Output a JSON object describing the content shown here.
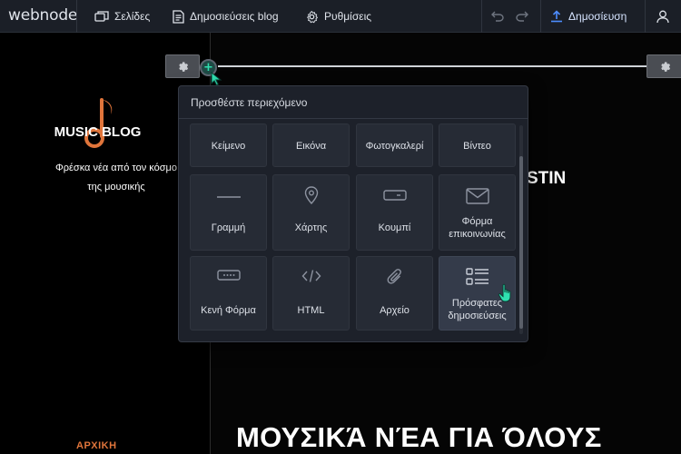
{
  "topbar": {
    "logo": "webnode",
    "nav": [
      {
        "label": "Σελίδες",
        "icon": "pages-icon"
      },
      {
        "label": "Δημοσιεύσεις blog",
        "icon": "blog-posts-icon"
      },
      {
        "label": "Ρυθμίσεις",
        "icon": "gear-icon"
      }
    ],
    "publish_label": "Δημοσίευση"
  },
  "site": {
    "blog_title": "MUSIC BLOG",
    "blog_subtitle_line1": "Φρέσκα νέα από τον κόσμο",
    "blog_subtitle_line2": "της μουσικής",
    "home_link": "ΑΡΧΙΚΗ",
    "partial_heading": "STIN",
    "big_heading": "ΜΟΥΣΙΚΆ ΝΈΑ ΓΙΑ ΌΛΟΥΣ"
  },
  "panel": {
    "title": "Προσθέστε περιεχόμενο",
    "row1": [
      "Κείμενο",
      "Εικόνα",
      "Φωτογκαλερί",
      "Βίντεο"
    ],
    "row2": [
      {
        "label1": "Γραμμή",
        "label2": "",
        "icon": "line-icon"
      },
      {
        "label1": "Χάρτης",
        "label2": "",
        "icon": "map-pin-icon"
      },
      {
        "label1": "Κουμπί",
        "label2": "",
        "icon": "button-icon"
      },
      {
        "label1": "Φόρμα",
        "label2": "επικοινωνίας",
        "icon": "envelope-icon"
      }
    ],
    "row3": [
      {
        "label1": "Κενή Φόρμα",
        "label2": "",
        "icon": "empty-form-icon"
      },
      {
        "label1": "HTML",
        "label2": "",
        "icon": "code-icon"
      },
      {
        "label1": "Αρχείο",
        "label2": "",
        "icon": "paperclip-icon"
      },
      {
        "label1": "Πρόσφατες",
        "label2": "δημοσιεύσεις",
        "icon": "recent-posts-icon"
      }
    ]
  },
  "colors": {
    "accent_teal": "#2fe0b0",
    "brand_orange": "#e0753b",
    "topbar_bg": "#1b1f27",
    "panel_bg": "#1d212a"
  }
}
